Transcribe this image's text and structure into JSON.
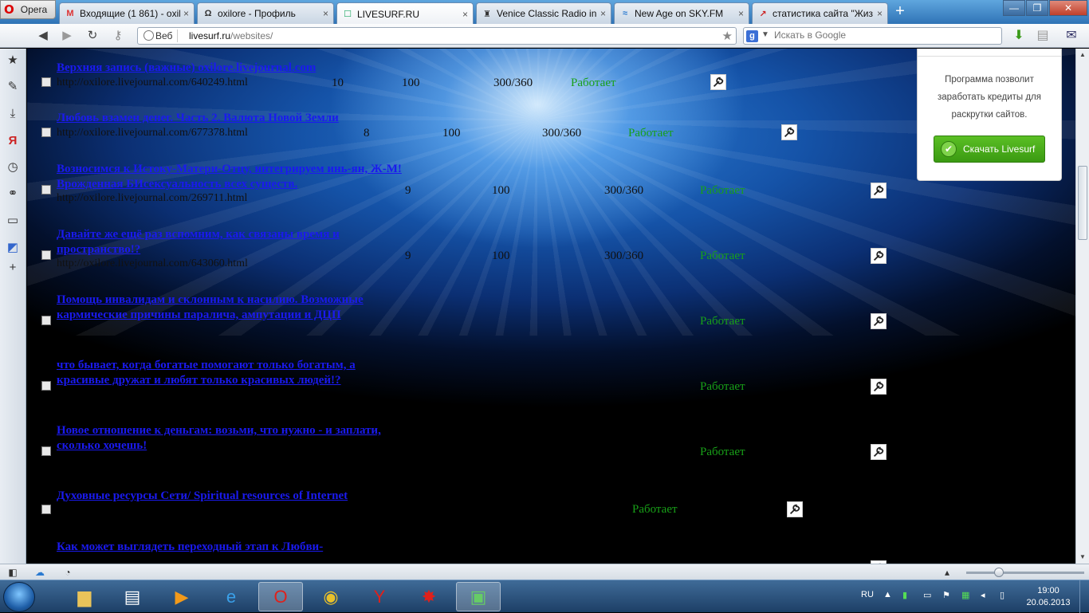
{
  "browser": {
    "opera_label": "Opera",
    "tabs": [
      {
        "title": "Входящие (1 861) - oxil...",
        "fav": "M"
      },
      {
        "title": "oxilore - Профиль",
        "fav": "Ω"
      },
      {
        "title": "LIVESURF.RU",
        "fav": "☐"
      },
      {
        "title": "Venice Classic Radio in ...",
        "fav": "♜"
      },
      {
        "title": "New Age on SKY.FM",
        "fav": "≈"
      },
      {
        "title": "статистика сайта \"Жиз...",
        "fav": "↗"
      }
    ],
    "close_glyph": "×",
    "new_tab_glyph": "+",
    "window_controls": [
      "—",
      "❐",
      "✕"
    ]
  },
  "address": {
    "web_label": "Веб",
    "url_host": "livesurf.ru",
    "url_path": "/websites/",
    "search_placeholder": "Искать в Google"
  },
  "rows": [
    {
      "title": "Верхняя запись (важные) oxilore.livejournal.com",
      "url": "http://oxilore.livejournal.com/640249.html",
      "a": "10",
      "b": "100",
      "c": "300/360",
      "status": "Работает"
    },
    {
      "title": "Любовь взамен денег. Часть 2. Валюта Новой Земли",
      "url": "http://oxilore.livejournal.com/677378.html",
      "a": "8",
      "b": "100",
      "c": "300/360",
      "status": "Работает"
    },
    {
      "title": "Возносимся к Истоку-Матери-Отцу, интегрируем инь-ян, Ж-М! Врожденная БИсексуальность всех существ.",
      "url": "http://oxilore.livejournal.com/269711.html",
      "a": "9",
      "b": "100",
      "c": "300/360",
      "status": "Работает"
    },
    {
      "title": "Давайте же ещё раз вспомним, как связаны время и пространство!?",
      "url": "http://oxilore.livejournal.com/643060.html",
      "a": "9",
      "b": "100",
      "c": "300/360",
      "status": "Работает"
    },
    {
      "title": "Помощь инвалидам и склонным к насилию. Возможные кармические причины паралича, ампутации и ДЦП",
      "url": "",
      "a": "",
      "b": "",
      "c": "",
      "status": "Работает"
    },
    {
      "title": "что бывает, когда богатые помогают только богатым, а красивые дружат и любят только красивых людей!?",
      "url": "",
      "a": "",
      "b": "",
      "c": "",
      "status": "Работает"
    },
    {
      "title": "Новое отношение к деньгам: возьми, что нужно - и заплати, сколько хочешь!",
      "url": "",
      "a": "",
      "b": "",
      "c": "",
      "status": "Работает"
    },
    {
      "title": "Духовные ресурсы Сети/ Spiritual resources of Internet",
      "url": "",
      "a": "",
      "b": "",
      "c": "",
      "status": "Работает"
    },
    {
      "title": "Как может выглядеть переходный этап к Любви-",
      "url": "",
      "a": "",
      "b": "",
      "c": "",
      "status": ""
    }
  ],
  "widget": {
    "description": "Программа позволит заработать кредиты для раскрутки сайтов.",
    "button": "Скачать Livesurf"
  },
  "taskbar": {
    "lang": "RU",
    "time": "19:00",
    "date": "20.06.2013"
  },
  "colors": {
    "link": "#1a1aee",
    "status_ok": "#18a018",
    "download_button": "#4aad1a"
  }
}
